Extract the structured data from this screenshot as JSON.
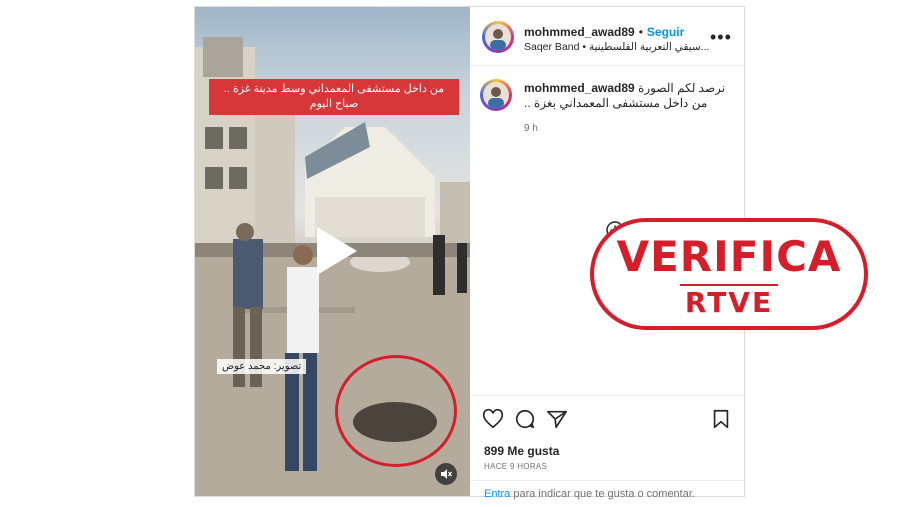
{
  "post": {
    "username": "mohmmed_awad89",
    "follow_label": "Seguir",
    "separator": "•",
    "music": "Saqer Band • سيقي التعربية الفلسطينية...",
    "more_label": "•••"
  },
  "media": {
    "overlay_caption": "من داخل مستشفى المعمداني وسط مدينة غزة .. صباح اليوم",
    "photo_credit": "تصوير: محمد عوض"
  },
  "comment": {
    "username": "mohmmed_awad89",
    "text": "نرصد لكم الصورة من داخل مستشفى المعمداني بغزة ..",
    "time": "9 h"
  },
  "actions": {
    "likes": "899 Me gusta",
    "timestamp": "HACE 9 HORAS",
    "comment_link": "Entra",
    "comment_prompt": " para indicar que te gusta o comentar."
  },
  "stamp": {
    "line1": "VERIFICA",
    "line2": "RTVE"
  },
  "colors": {
    "accent": "#0095f6",
    "stamp_red": "#d61e2a",
    "caption_bg": "#d8373a"
  }
}
